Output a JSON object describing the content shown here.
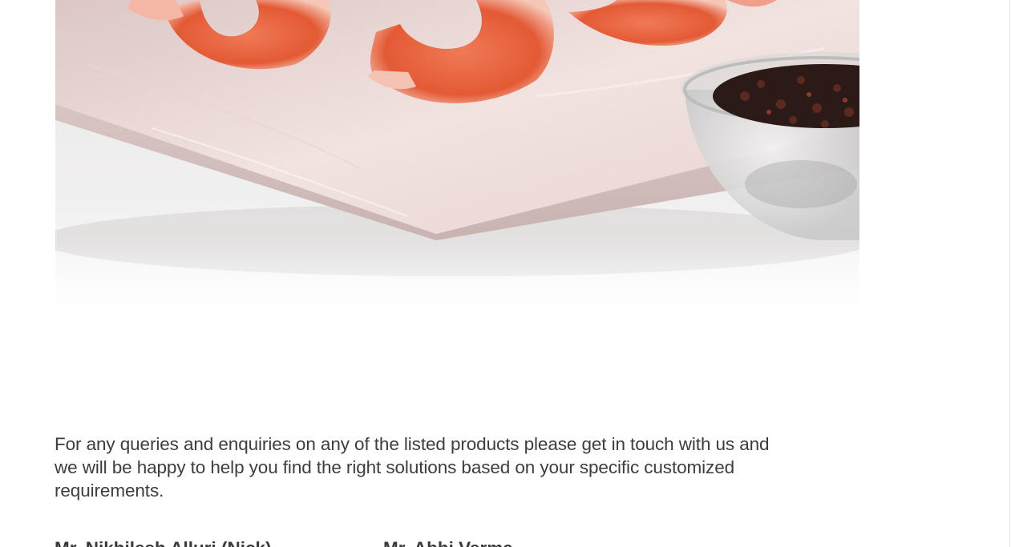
{
  "hero": {
    "alt_icon": "shrimp-on-marble-board-photo"
  },
  "enquiry": {
    "text": "For any queries and enquiries on any of the listed products please get in touch with us and we will be happy to help you find the right solutions based on your specific customized requirements."
  },
  "contacts": [
    {
      "name": "Mr. Nikhilesh Alluri (Nick)"
    },
    {
      "name": "Mr. Abhi Verma"
    }
  ],
  "colors": {
    "text": "#3d3d3d",
    "shrimp": "#e8623f",
    "marble": "#ecd9d6"
  }
}
